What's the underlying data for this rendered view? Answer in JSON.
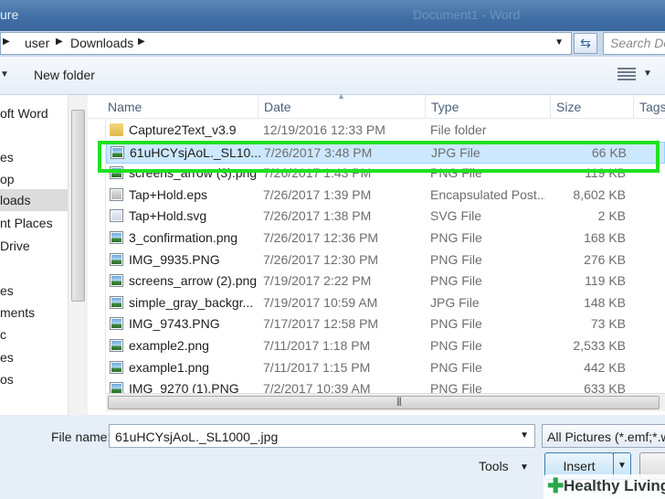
{
  "window": {
    "title_partial": "ure",
    "app_title": "Document1 - Word"
  },
  "address": {
    "segments": [
      "user",
      "Downloads"
    ],
    "search_placeholder": "Search Do"
  },
  "toolbar": {
    "new_folder": "New folder"
  },
  "nav": {
    "items": [
      "oft Word",
      "es",
      "op",
      "loads",
      "nt Places",
      "Drive",
      "es",
      "ments",
      "c",
      "es",
      "os"
    ],
    "selected_index": 3
  },
  "columns": {
    "name": "Name",
    "date": "Date",
    "type": "Type",
    "size": "Size",
    "tags": "Tags"
  },
  "files": [
    {
      "name": "Capture2Text_v3.9",
      "date": "12/19/2016 12:33 PM",
      "type": "File folder",
      "size": "",
      "icon": "folder-icon"
    },
    {
      "name": "61uHCYsjAoL._SL10...",
      "date": "7/26/2017 3:48 PM",
      "type": "JPG File",
      "size": "66 KB",
      "icon": "image-file-icon"
    },
    {
      "name": "screens_arrow (3).png",
      "date": "7/26/2017 1:43 PM",
      "type": "PNG File",
      "size": "119 KB",
      "icon": "image-file-icon"
    },
    {
      "name": "Tap+Hold.eps",
      "date": "7/26/2017 1:39 PM",
      "type": "Encapsulated Post...",
      "size": "8,602 KB",
      "icon": "eps-file-icon"
    },
    {
      "name": "Tap+Hold.svg",
      "date": "7/26/2017 1:38 PM",
      "type": "SVG File",
      "size": "2 KB",
      "icon": "svg-file-icon"
    },
    {
      "name": "3_confirmation.png",
      "date": "7/26/2017 12:36 PM",
      "type": "PNG File",
      "size": "168 KB",
      "icon": "image-file-icon"
    },
    {
      "name": "IMG_9935.PNG",
      "date": "7/26/2017 12:30 PM",
      "type": "PNG File",
      "size": "276 KB",
      "icon": "image-file-icon"
    },
    {
      "name": "screens_arrow (2).png",
      "date": "7/19/2017 2:22 PM",
      "type": "PNG File",
      "size": "119 KB",
      "icon": "image-file-icon"
    },
    {
      "name": "simple_gray_backgr...",
      "date": "7/19/2017 10:59 AM",
      "type": "JPG File",
      "size": "148 KB",
      "icon": "image-file-icon"
    },
    {
      "name": "IMG_9743.PNG",
      "date": "7/17/2017 12:58 PM",
      "type": "PNG File",
      "size": "73 KB",
      "icon": "image-file-icon"
    },
    {
      "name": "example2.png",
      "date": "7/11/2017 1:18 PM",
      "type": "PNG File",
      "size": "2,533 KB",
      "icon": "image-file-icon"
    },
    {
      "name": "example1.png",
      "date": "7/11/2017 1:15 PM",
      "type": "PNG File",
      "size": "442 KB",
      "icon": "image-file-icon"
    },
    {
      "name": "IMG_9270 (1).PNG",
      "date": "7/2/2017 10:39 AM",
      "type": "PNG File",
      "size": "633 KB",
      "icon": "image-file-icon"
    }
  ],
  "selected_file_index": 1,
  "footer": {
    "file_name_label": "File name:",
    "file_name_value": "61uHCYsjAoL._SL1000_.jpg",
    "filter": "All Pictures (*.emf;*.w",
    "tools": "Tools",
    "insert": "Insert"
  },
  "watermark": {
    "text": "Healthy Living"
  },
  "colors": {
    "highlight": "#21e021",
    "selection": "#cce8ff",
    "titlebar": "#3f6ea5"
  }
}
